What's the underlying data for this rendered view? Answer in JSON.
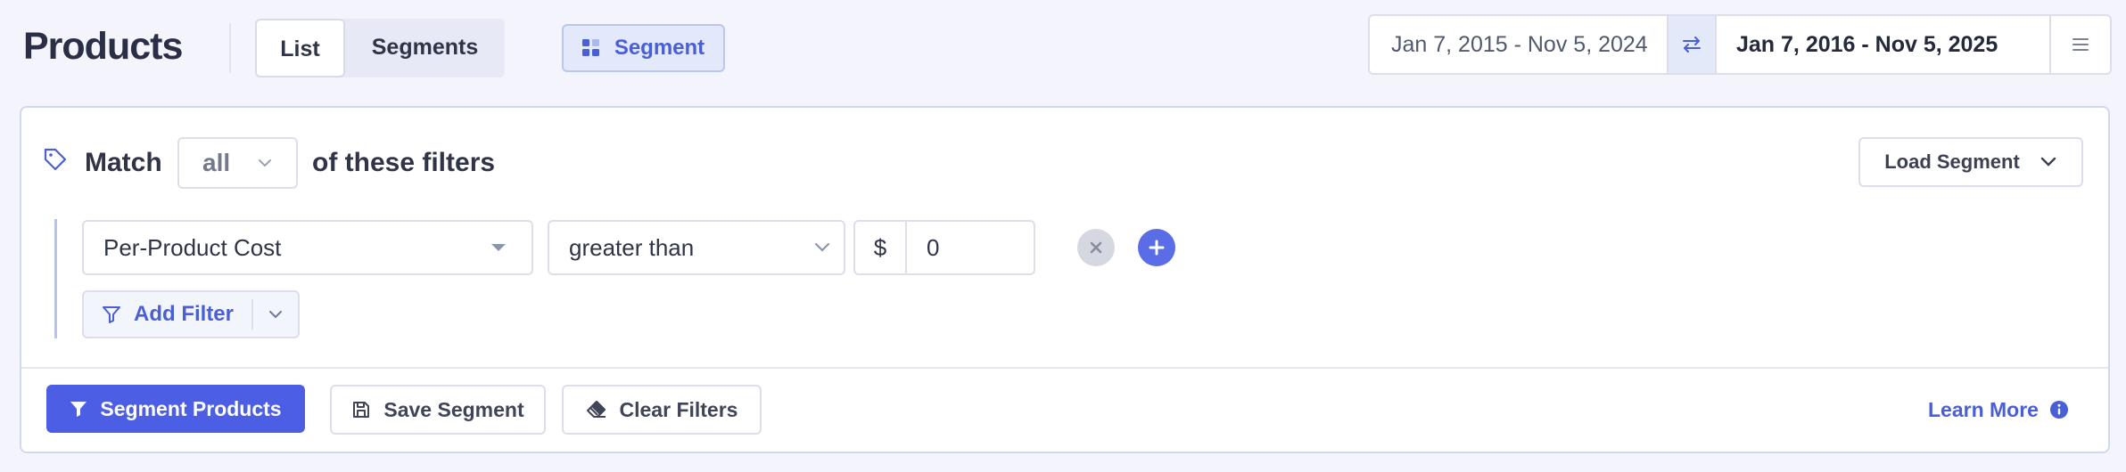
{
  "header": {
    "title": "Products",
    "tabs": [
      {
        "label": "List",
        "active": true
      },
      {
        "label": "Segments",
        "active": false
      }
    ],
    "segment_button": {
      "label": "Segment",
      "icon": "grid-icon"
    },
    "date_range": {
      "compare_range": "Jan 7, 2015 - Nov 5, 2024",
      "primary_range": "Jan 7, 2016 - Nov 5, 2025",
      "swap_icon": "swap-arrows-icon",
      "menu_icon": "hamburger-menu-icon"
    }
  },
  "filter_panel": {
    "match_prefix": "Match",
    "match_value": "all",
    "match_suffix": "of these filters",
    "load_segment_label": "Load Segment",
    "filters": [
      {
        "field": "Per-Product Cost",
        "operator": "greater than",
        "value_prefix": "$",
        "value": "0"
      }
    ],
    "add_filter_label": "Add Filter",
    "actions": {
      "segment_products": "Segment Products",
      "save_segment": "Save Segment",
      "clear_filters": "Clear Filters",
      "learn_more": "Learn More"
    }
  },
  "colors": {
    "accent": "#4c5ee3",
    "background": "#f4f4fd",
    "panel_border": "#cfd9ec",
    "text": "#2f3547"
  }
}
